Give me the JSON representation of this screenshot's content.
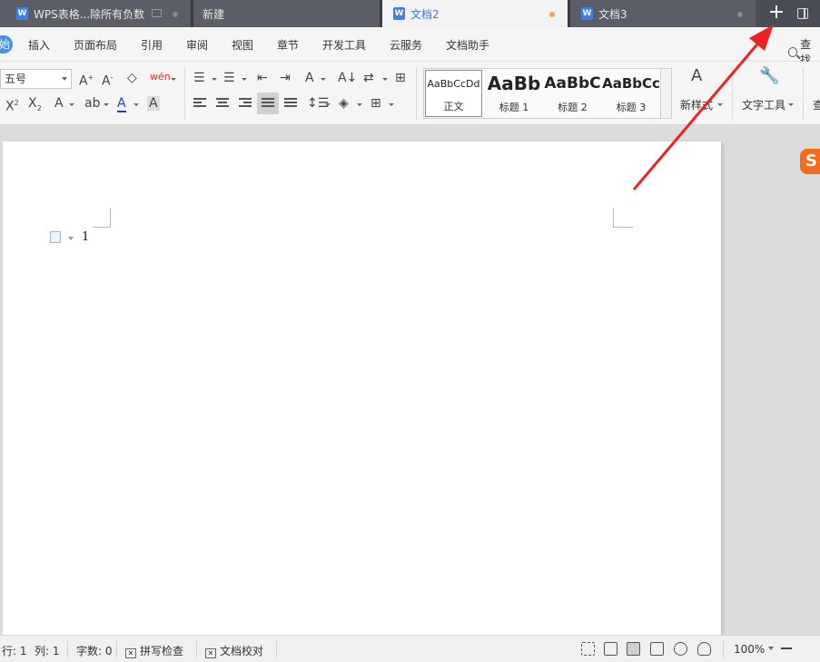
{
  "tabs": [
    {
      "label": "WPS表格...除所有负数"
    },
    {
      "label": "新建"
    },
    {
      "label": "文档2"
    },
    {
      "label": "文档3"
    }
  ],
  "new_tab_icon": "+",
  "menu": {
    "start_fragment": "始",
    "items": [
      "插入",
      "页面布局",
      "引用",
      "审阅",
      "视图",
      "章节",
      "开发工具",
      "云服务",
      "文档助手"
    ],
    "search_label": "查找"
  },
  "ribbon": {
    "font_size_value": "五号",
    "styles": [
      {
        "sample": "AaBbCcDd",
        "name": "正文"
      },
      {
        "sample": "AaBb",
        "name": "标题 1"
      },
      {
        "sample": "AaBbC",
        "name": "标题 2"
      },
      {
        "sample": "AaBbCc",
        "name": "标题 3"
      }
    ],
    "new_style_label": "新样式",
    "text_tools_label": "文字工具",
    "cut_label": "查"
  },
  "document": {
    "text": "1"
  },
  "statusbar": {
    "row": "行: 1",
    "col": "列: 1",
    "word_count": "字数: 0",
    "spell_check": "拼写检查",
    "proofread": "文档校对",
    "zoom": "100%"
  },
  "colors": {
    "tab_bar": "#4a4d55",
    "active_tab_text": "#3a78d8",
    "arrow": "#ee2222",
    "sogou": "#f36b1e"
  }
}
